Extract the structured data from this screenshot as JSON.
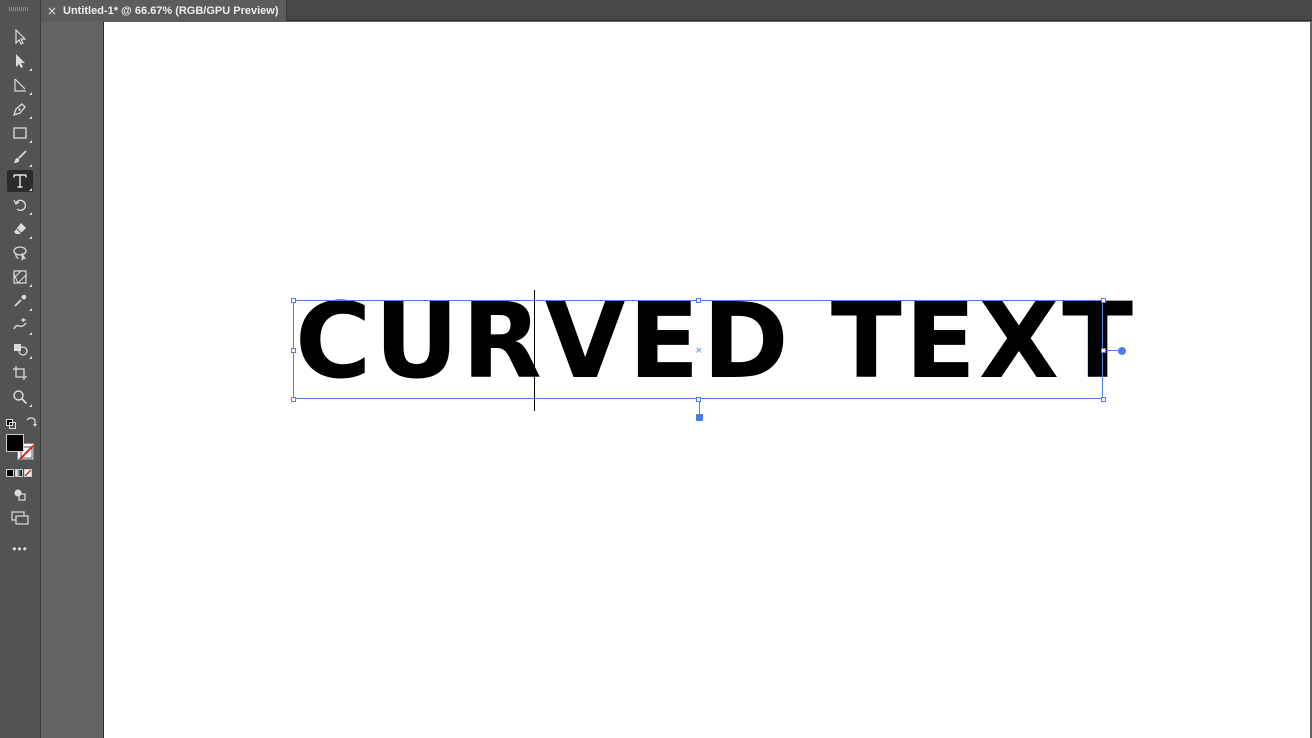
{
  "document_tab": {
    "close_label": "×",
    "title": "Untitled-1* @ 66.67% (RGB/GPU Preview)"
  },
  "toolbar": {
    "tools": [
      "selection-tool",
      "direct-selection-tool",
      "line-segment-tool",
      "pen-tool",
      "rectangle-tool",
      "paintbrush-tool",
      "type-tool",
      "rotate-tool",
      "eraser-tool",
      "lasso-tool",
      "free-transform-tool",
      "eyedropper-tool",
      "width-tool",
      "shape-builder-tool",
      "artboard-tool",
      "zoom-tool"
    ],
    "active_tool": "type-tool",
    "fill_color": "#000000",
    "stroke": "none",
    "more_label": "•••"
  },
  "canvas": {
    "text": "CURVED TEXT",
    "selection_color": "#4a7fe8"
  }
}
